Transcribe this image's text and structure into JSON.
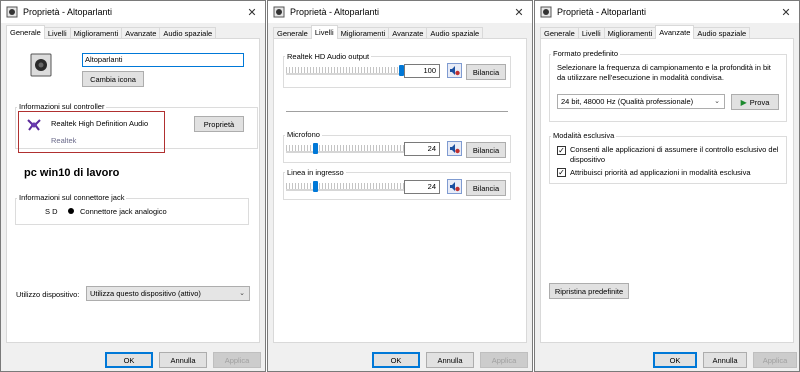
{
  "windows": [
    {
      "title": "Proprietà - Altoparlanti",
      "tabs": [
        "Generale",
        "Livelli",
        "Miglioramenti",
        "Avanzate",
        "Audio spaziale"
      ],
      "active_tab": "Generale"
    },
    {
      "title": "Proprietà - Altoparlanti",
      "tabs": [
        "Generale",
        "Livelli",
        "Miglioramenti",
        "Avanzate",
        "Audio spaziale"
      ],
      "active_tab": "Livelli"
    },
    {
      "title": "Proprietà - Altoparlanti",
      "tabs": [
        "Generale",
        "Livelli",
        "Miglioramenti",
        "Avanzate",
        "Audio spaziale"
      ],
      "active_tab": "Avanzate"
    }
  ],
  "buttons": {
    "ok": "OK",
    "cancel": "Annulla",
    "apply": "Applica"
  },
  "general": {
    "device_name": "Altoparlanti",
    "change_icon": "Cambia icona",
    "controller_group": "Informazioni sul controller",
    "controller_name": "Realtek High Definition Audio",
    "controller_vendor": "Realtek",
    "properties_button": "Proprietà",
    "annotation": "pc win10 di lavoro",
    "jack_group": "Informazioni sul connettore jack",
    "jack_position": "S D",
    "jack_type": "Connettore jack analogico",
    "usage_label": "Utilizzo dispositivo:",
    "usage_value": "Utilizza questo dispositivo (attivo)"
  },
  "levels": {
    "balance_label": "Bilancia",
    "items": [
      {
        "label": "Realtek HD Audio output",
        "value": "100",
        "level": 100
      },
      {
        "label": "Microfono",
        "value": "24",
        "level": 24
      },
      {
        "label": "Linea in ingresso",
        "value": "24",
        "level": 24
      }
    ]
  },
  "advanced": {
    "format_group": "Formato predefinito",
    "format_desc": "Selezionare la frequenza di campionamento e la profondità in bit da utilizzare nell'esecuzione in modalità condivisa.",
    "format_value": "24 bit, 48000 Hz (Qualità professionale)",
    "test_button": "Prova",
    "exclusive_group": "Modalità esclusiva",
    "exclusive_option1": "Consenti alle applicazioni di assumere il controllo esclusivo del dispositivo",
    "exclusive_option1_checked": true,
    "exclusive_option2": "Attribuisci priorità ad applicazioni in modalità esclusiva",
    "exclusive_option2_checked": true,
    "restore_button": "Ripristina predefinite"
  },
  "colors": {
    "accent": "#0078d7",
    "highlight_border": "#b03030"
  }
}
